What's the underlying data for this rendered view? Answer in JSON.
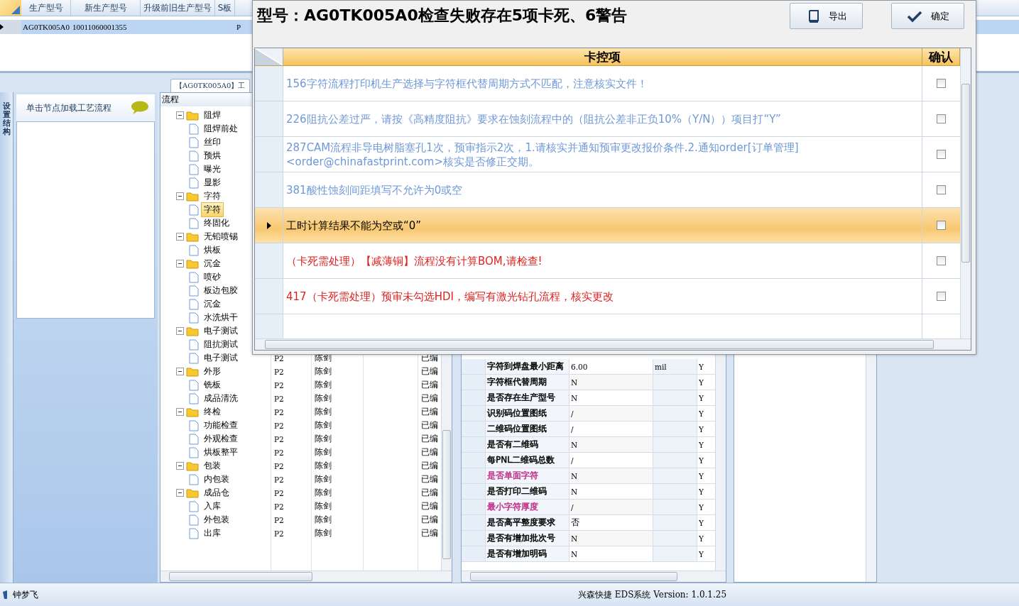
{
  "top_grid": {
    "columns": [
      "生产型号",
      "新生产型号",
      "升级前旧生产型号",
      "S板"
    ],
    "rows": [
      {
        "model": "AG0TK005A0",
        "new_model": "10011060001355",
        "column_5": "P",
        "selected": true
      }
    ]
  },
  "doc_tab": {
    "label": "【AG0TK005A0】工"
  },
  "side_tab": {
    "label": "设置结构"
  },
  "side_panel": {
    "title": "单击节点加载工艺流程"
  },
  "flow_tree": {
    "header": "流程",
    "nodes": [
      {
        "label": "阻焊",
        "expanded": true,
        "children": [
          {
            "label": "阻焊前处"
          },
          {
            "label": "丝印"
          },
          {
            "label": "预烘"
          },
          {
            "label": "曝光"
          },
          {
            "label": "显影"
          }
        ]
      },
      {
        "label": "字符",
        "expanded": true,
        "children": [
          {
            "label": "字符",
            "selected": true
          },
          {
            "label": "终固化"
          }
        ]
      },
      {
        "label": "无铅喷锡",
        "expanded": true,
        "children": [
          {
            "label": "烘板"
          }
        ]
      },
      {
        "label": "沉金",
        "expanded": true,
        "children": [
          {
            "label": "喷砂"
          },
          {
            "label": "板边包胶"
          },
          {
            "label": "沉金"
          },
          {
            "label": "水洗烘干"
          }
        ]
      },
      {
        "label": "电子测试",
        "expanded": true,
        "children": [
          {
            "label": "阻抗测试"
          },
          {
            "label": "电子测试",
            "cells": [
              "P2",
              "陈剑",
              "已编"
            ]
          }
        ]
      },
      {
        "label": "外形",
        "expanded": true,
        "cells": [
          "P2",
          "陈剑",
          "已编"
        ],
        "children": [
          {
            "label": "铣板",
            "cells": [
              "P2",
              "陈剑",
              "已编"
            ]
          },
          {
            "label": "成品清洗",
            "cells": [
              "P2",
              "陈剑",
              "已编"
            ]
          }
        ]
      },
      {
        "label": "终检",
        "expanded": true,
        "cells": [
          "P2",
          "陈剑",
          "已编"
        ],
        "children": [
          {
            "label": "功能检查",
            "cells": [
              "P2",
              "陈剑",
              "已编"
            ]
          },
          {
            "label": "外观检查",
            "cells": [
              "P2",
              "陈剑",
              "已编"
            ]
          },
          {
            "label": "烘板整平",
            "cells": [
              "P2",
              "陈剑",
              "已编"
            ]
          }
        ]
      },
      {
        "label": "包装",
        "expanded": true,
        "cells": [
          "P2",
          "陈剑",
          "已编"
        ],
        "children": [
          {
            "label": "内包装",
            "cells": [
              "P2",
              "陈剑",
              "已编"
            ]
          }
        ]
      },
      {
        "label": "成品仓",
        "expanded": true,
        "cells": [
          "P2",
          "陈剑",
          "已编"
        ],
        "children": [
          {
            "label": "入库",
            "cells": [
              "P2",
              "陈剑",
              "已编"
            ]
          },
          {
            "label": "外包装",
            "cells": [
              "P2",
              "陈剑",
              "已编"
            ]
          },
          {
            "label": "出库",
            "cells": [
              "P2",
              "陈剑",
              "已编"
            ]
          }
        ]
      }
    ]
  },
  "property_grid": {
    "rows": [
      {
        "name": "字符到焊盘最小距离",
        "value": "6.00",
        "unit": "mil",
        "required": "Y"
      },
      {
        "name": "字符框代替周期",
        "value": "N",
        "required": "Y"
      },
      {
        "name": "是否存在生产型号",
        "value": "N",
        "required": "Y"
      },
      {
        "name": "识别码位置图纸",
        "value": "/",
        "required": "Y"
      },
      {
        "name": "二维码位置图纸",
        "value": "/",
        "required": "Y"
      },
      {
        "name": "是否有二维码",
        "value": "N",
        "required": "Y"
      },
      {
        "name": "每PNL二维码总数",
        "value": "/",
        "required": "Y"
      },
      {
        "name": "是否单面字符",
        "value": "N",
        "required": "Y",
        "color": "#c0308a"
      },
      {
        "name": "是否打印二维码",
        "value": "N",
        "required": "Y"
      },
      {
        "name": "最小字符厚度",
        "value": "/",
        "required": "Y",
        "color": "#c0308a"
      },
      {
        "name": "是否高平整度要求",
        "value": "否",
        "required": "Y"
      },
      {
        "name": "是否有增加批次号",
        "value": "N",
        "required": "Y"
      },
      {
        "name": "是否有增加明码",
        "value": "N",
        "required": "Y"
      }
    ]
  },
  "dialog": {
    "title": "型号：AG0TK005A0检查失败存在5项卡死、6警告",
    "buttons": [
      {
        "kind": "export",
        "label": "导出"
      },
      {
        "kind": "confirm",
        "label": "确定"
      }
    ],
    "columns": [
      "卡控项",
      "确认"
    ],
    "rows": [
      {
        "kind": "warning",
        "text": "156字符流程打印机生产选择与字符框代替周期方式不匹配，注意核实文件！",
        "selected": false,
        "checked": false
      },
      {
        "kind": "warning",
        "text": "226阻抗公差过严，请按《高精度阻抗》要求在蚀刻流程中的（阻抗公差非正负10%（Y/N））项目打“Y”",
        "selected": false,
        "checked": false
      },
      {
        "kind": "warning",
        "text": "287CAM流程非导电树脂塞孔1次，预审指示2次，1.请核实并通知预审更改报价条件.2.通知order[订单管理] <order@chinafastprint.com>核实是否修正交期。",
        "selected": false,
        "checked": false
      },
      {
        "kind": "warning",
        "text": "381酸性蚀刻间距填写不允许为0或空",
        "selected": false,
        "checked": false
      },
      {
        "kind": "warning",
        "text": "工时计算结果不能为空或“0”",
        "selected": true,
        "checked": false
      },
      {
        "kind": "error",
        "text": "（卡死需处理）【减薄铜】流程没有计算BOM,请检查!",
        "selected": false,
        "checked": false
      },
      {
        "kind": "error",
        "text": "417（卡死需处理）预审未勾选HDI，编写有激光钻孔流程，核实更改",
        "selected": false,
        "checked": false
      }
    ]
  },
  "status_bar": {
    "user": "钟梦飞",
    "version": "兴森快捷 EDS系统 Version: 1.0.1.25"
  }
}
